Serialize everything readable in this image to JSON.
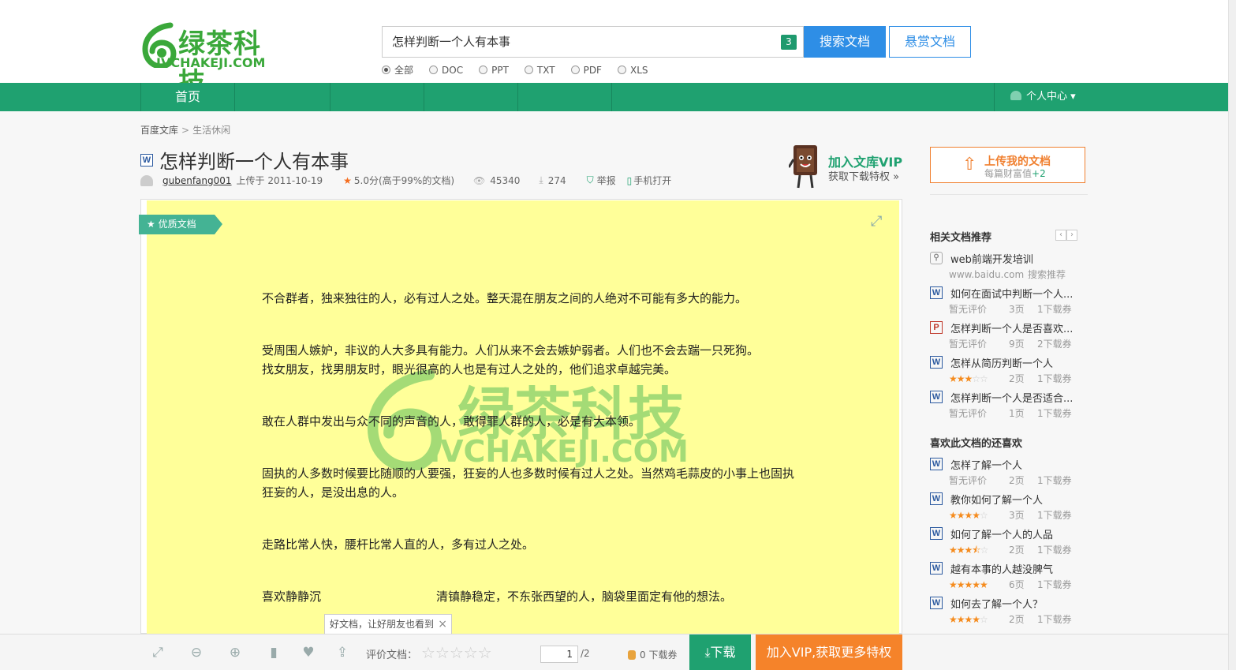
{
  "header": {
    "logo_text": "绿茶科技",
    "logo_sub": "IVCHAKEJI.COM",
    "search_value": "怎样判断一个人有本事",
    "search_count": "3",
    "search_button": "搜索文档",
    "bounty_button": "悬赏文档",
    "filters": [
      "全部",
      "DOC",
      "PPT",
      "TXT",
      "PDF",
      "XLS"
    ],
    "selected_filter": "全部"
  },
  "nav": {
    "home": "首页",
    "user_center": "个人中心"
  },
  "breadcrumb": {
    "root": "百度文库",
    "current": "生活休闲"
  },
  "document": {
    "title": "怎样判断一个人有本事",
    "author": "gubenfang001",
    "uploaded": "上传于 2011-10-19",
    "rating": "5.0分(高于99%的文档)",
    "views": "45340",
    "downloads": "274",
    "report": "举报",
    "mobile": "手机打开",
    "quality_tag": "优质文档",
    "paragraphs": [
      "不合群者，独来独往的人，必有过人之处。整天混在朋友之间的人绝对不可能有多大的能力。",
      "受周围人嫉妒，非议的人大多具有能力。人们从来不会去嫉妒弱者。人们也不会去踹一只死狗。",
      "找女朋友，找男朋友时，眼光很高的人也是有过人之处的，他们追求卓越完美。",
      "敢在人群中发出与众不同的声音的人，敢得罪人群的人，必是有大本领。",
      "固执的人多数时候要比随顺的人要强，狂妄的人也多数时候有过人之处。当然鸡毛蒜皮的小事上也固执狂妄的人，是没出息的人。",
      "走路比常人快，腰杆比常人直的人，多有过人之处。",
      "喜欢静静沉",
      "清镇静稳定，不东张西望的人，脑袋里面定有他的想法。"
    ],
    "watermark_text": "绿茶科技",
    "watermark_sub": "IVCHAKEJI.COM"
  },
  "vip_promo": {
    "title": "加入文库VIP",
    "subtitle": "获取下载特权 »"
  },
  "upload": {
    "title": "上传我的文档",
    "subtitle": "每篇财富值",
    "bonus": "+2"
  },
  "sidebar": {
    "related_heading": "相关文档推荐",
    "related": [
      {
        "icon": "link",
        "title": "web前端开发培训",
        "meta1": "www.baidu.com",
        "meta2": "搜索推荐"
      },
      {
        "icon": "W",
        "title": "如何在面试中判断一个人...",
        "rating": "暂无评价",
        "pages": "3页",
        "coupon": "1下载券"
      },
      {
        "icon": "P",
        "title": "怎样判断一个人是否喜欢...",
        "rating": "暂无评价",
        "pages": "9页",
        "coupon": "2下载券"
      },
      {
        "icon": "W",
        "title": "怎样从简历判断一个人",
        "stars": 3,
        "pages": "2页",
        "coupon": "1下载券"
      },
      {
        "icon": "W",
        "title": "怎样判断一个人是否适合...",
        "rating": "暂无评价",
        "pages": "1页",
        "coupon": "1下载券"
      }
    ],
    "liked_heading": "喜欢此文档的还喜欢",
    "liked": [
      {
        "icon": "W",
        "title": "怎样了解一个人",
        "rating": "暂无评价",
        "pages": "2页",
        "coupon": "1下载券"
      },
      {
        "icon": "W",
        "title": "教你如何了解一个人",
        "stars": 4,
        "pages": "3页",
        "coupon": "1下载券"
      },
      {
        "icon": "W",
        "title": "如何了解一个人的人品",
        "stars": 3.5,
        "pages": "2页",
        "coupon": "1下载券"
      },
      {
        "icon": "W",
        "title": "越有本事的人越没脾气",
        "stars": 5,
        "pages": "6页",
        "coupon": "1下载券"
      },
      {
        "icon": "W",
        "title": "如何去了解一个人？",
        "stars": 4,
        "pages": "2页",
        "coupon": "1下载券"
      }
    ]
  },
  "toolbar": {
    "share_tip": "好文档，让好朋友也看到",
    "rate_label": "评价文档：",
    "page_current": "1",
    "page_total": "/2",
    "coupons": "0 下载券",
    "download_button": "下载",
    "vip_button": "加入VIP,获取更多特权"
  },
  "colors": {
    "brand_green": "#1fa170",
    "search_blue": "#2e8ee6",
    "orange": "#f5832a",
    "page_yellow": "#ffff99"
  }
}
